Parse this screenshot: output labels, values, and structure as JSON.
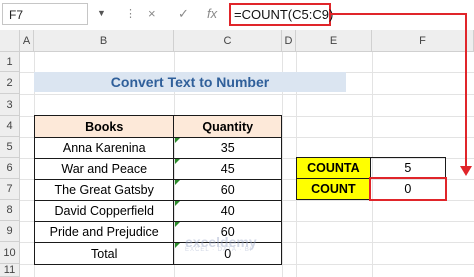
{
  "formula_bar": {
    "name_box": "F7",
    "formula": "=COUNT(C5:C9)",
    "cancel_icon": "×",
    "enter_icon": "✓",
    "fx_icon": "fx"
  },
  "columns": [
    "A",
    "B",
    "C",
    "D",
    "E",
    "F"
  ],
  "rows": [
    "1",
    "2",
    "3",
    "4",
    "5",
    "6",
    "7",
    "8",
    "9",
    "10",
    "11"
  ],
  "title": "Convert Text to Number",
  "table": {
    "headers": [
      "Books",
      "Quantity"
    ],
    "rows": [
      [
        "Anna Karenina",
        "35"
      ],
      [
        "War and Peace",
        "45"
      ],
      [
        "The Great Gatsby",
        "60"
      ],
      [
        "David Copperfield",
        "40"
      ],
      [
        "Pride and Prejudice",
        "60"
      ],
      [
        "Total",
        "0"
      ]
    ]
  },
  "summary": [
    {
      "label": "COUNTA",
      "value": "5"
    },
    {
      "label": "COUNT",
      "value": "0"
    }
  ],
  "colors": {
    "title_bg": "#dbe5f1",
    "header_bg": "#fde9d9",
    "highlight": "#e0252a",
    "summary_label_bg": "#ffff00"
  },
  "watermark": {
    "brand": "exceldemy",
    "tagline": "EXCEL · DATA · BI"
  }
}
